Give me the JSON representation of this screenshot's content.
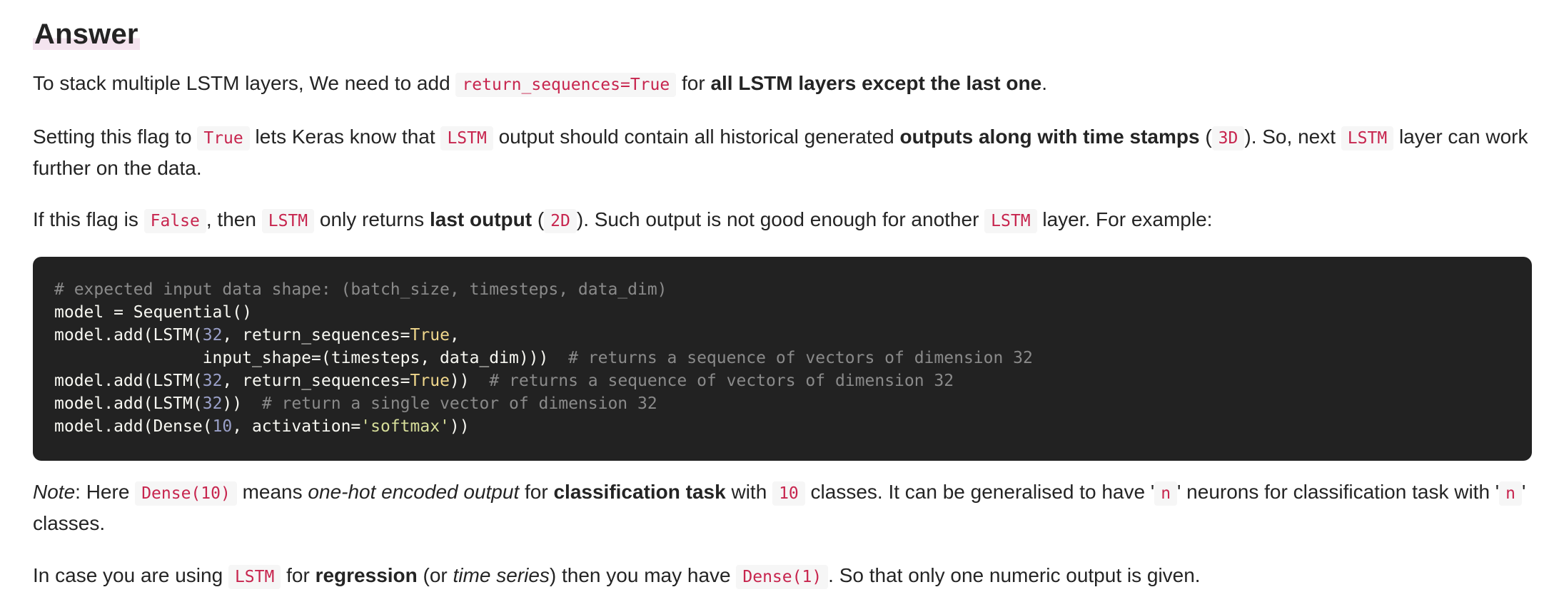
{
  "heading": "Answer",
  "p1": {
    "t1": "To stack multiple LSTM layers, We need to add ",
    "c1": "return_sequences=True",
    "t2": " for ",
    "b1": "all LSTM layers except the last one",
    "t3": "."
  },
  "p2": {
    "t1": "Setting this flag to ",
    "c1": "True",
    "t2": " lets Keras know that ",
    "c2": "LSTM",
    "t3": " output should contain all historical generated ",
    "b1": "outputs along with time stamps",
    "t4": " (",
    "c3": "3D",
    "t5": "). So, next ",
    "c4": "LSTM",
    "t6": " layer can work further on the data."
  },
  "p3": {
    "t1": "If this flag is ",
    "c1": "False",
    "t2": ", then ",
    "c2": "LSTM",
    "t3": " only returns ",
    "b1": "last output",
    "t4": " (",
    "c3": "2D",
    "t5": "). Such output is not good enough for another ",
    "c4": "LSTM",
    "t6": " layer. For example:"
  },
  "code": {
    "l1_comment": "# expected input data shape: (batch_size, timesteps, data_dim)",
    "l2": "model = Sequential()",
    "l3_a": "model.add(LSTM(",
    "l3_num": "32",
    "l3_b": ", return_sequences=",
    "l3_kw": "True",
    "l3_c": ",",
    "l4_a": "               input_shape=(timesteps, data_dim)))  ",
    "l4_comment": "# returns a sequence of vectors of dimension 32",
    "l5_a": "model.add(LSTM(",
    "l5_num": "32",
    "l5_b": ", return_sequences=",
    "l5_kw": "True",
    "l5_c": "))  ",
    "l5_comment": "# returns a sequence of vectors of dimension 32",
    "l6_a": "model.add(LSTM(",
    "l6_num": "32",
    "l6_b": "))  ",
    "l6_comment": "# return a single vector of dimension 32",
    "l7_a": "model.add(Dense(",
    "l7_num": "10",
    "l7_b": ", activation=",
    "l7_str": "'softmax'",
    "l7_c": "))"
  },
  "p4": {
    "i1": "Note",
    "t1": ": Here ",
    "c1": "Dense(10)",
    "t2": " means ",
    "i2": "one-hot encoded output",
    "t3": " for ",
    "b1": "classification task",
    "t4": " with ",
    "c2": "10",
    "t5": " classes. It can be generalised to have '",
    "c3": "n",
    "t6": "' neurons for classification task with '",
    "c4": "n",
    "t7": "' classes."
  },
  "p5": {
    "t1": "In case you are using ",
    "c1": "LSTM",
    "t2": " for ",
    "b1": "regression",
    "t3": " (or ",
    "i1": "time series",
    "t4": ") then you may have ",
    "c2": "Dense(1)",
    "t5": ". So that only one numeric output is given."
  }
}
